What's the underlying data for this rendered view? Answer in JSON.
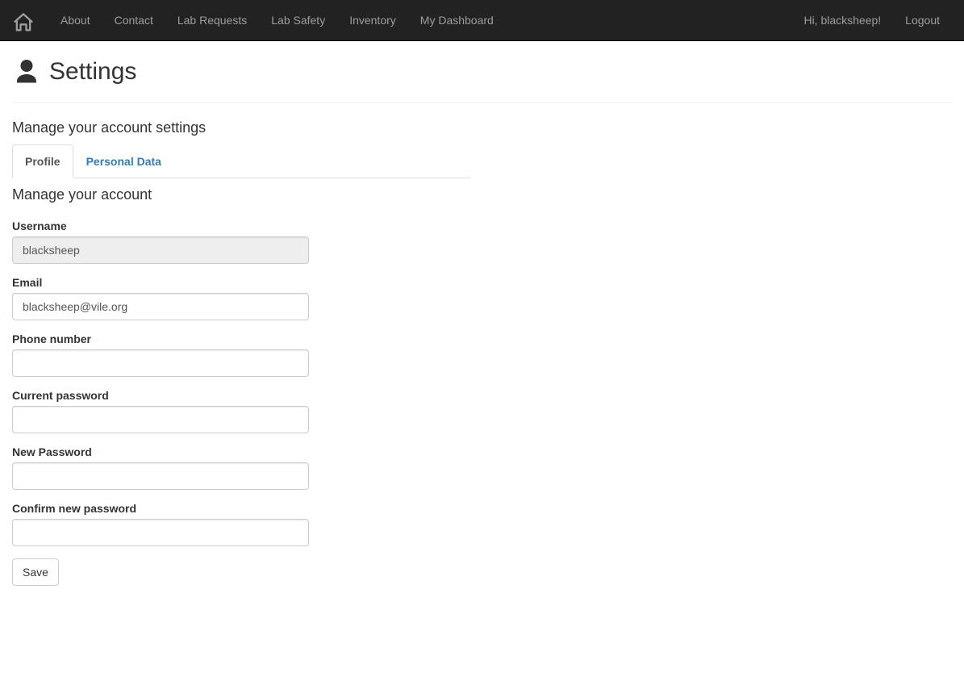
{
  "nav": {
    "items": [
      "About",
      "Contact",
      "Lab Requests",
      "Lab Safety",
      "Inventory",
      "My Dashboard"
    ],
    "greeting": "Hi, blacksheep!",
    "logout": "Logout"
  },
  "page": {
    "title": "Settings",
    "subtitle": "Manage your account settings"
  },
  "tabs": [
    {
      "label": "Profile",
      "active": true
    },
    {
      "label": "Personal Data",
      "active": false
    }
  ],
  "section_heading": "Manage your account",
  "form": {
    "username_label": "Username",
    "username_value": "blacksheep",
    "email_label": "Email",
    "email_value": "blacksheep@vile.org",
    "phone_label": "Phone number",
    "phone_value": "",
    "currentpw_label": "Current password",
    "currentpw_value": "",
    "newpw_label": "New Password",
    "newpw_value": "",
    "confirmpw_label": "Confirm new password",
    "confirmpw_value": "",
    "save_label": "Save"
  }
}
